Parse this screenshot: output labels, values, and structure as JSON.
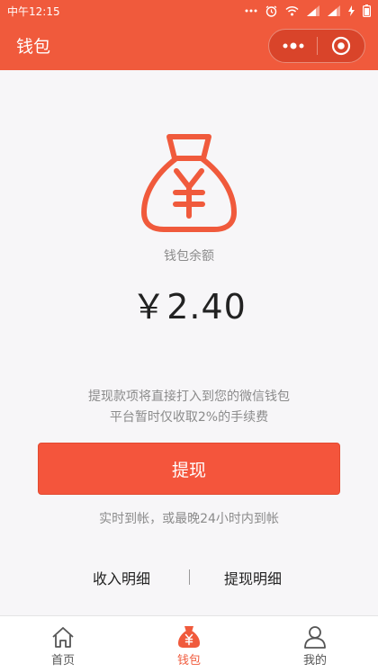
{
  "status_bar": {
    "time": "中午12:15"
  },
  "nav": {
    "title": "钱包"
  },
  "wallet": {
    "balance_label": "钱包余额",
    "balance": "￥2.40",
    "notice_line1": "提现款项将直接打入到您的微信钱包",
    "notice_line2": "平台暂时仅收取2%的手续费",
    "withdraw_button": "提现",
    "arrival_note": "实时到帐，或最晚24小时内到帐",
    "income_detail": "收入明细",
    "withdraw_detail": "提现明细"
  },
  "tabs": [
    {
      "label": "首页",
      "icon": "home-icon",
      "active": false
    },
    {
      "label": "钱包",
      "icon": "wallet-bag-icon",
      "active": true
    },
    {
      "label": "我的",
      "icon": "user-icon",
      "active": false
    }
  ],
  "colors": {
    "primary": "#f05a3c",
    "button": "#f4553c",
    "muted": "#8b8b8b",
    "text": "#222222"
  }
}
